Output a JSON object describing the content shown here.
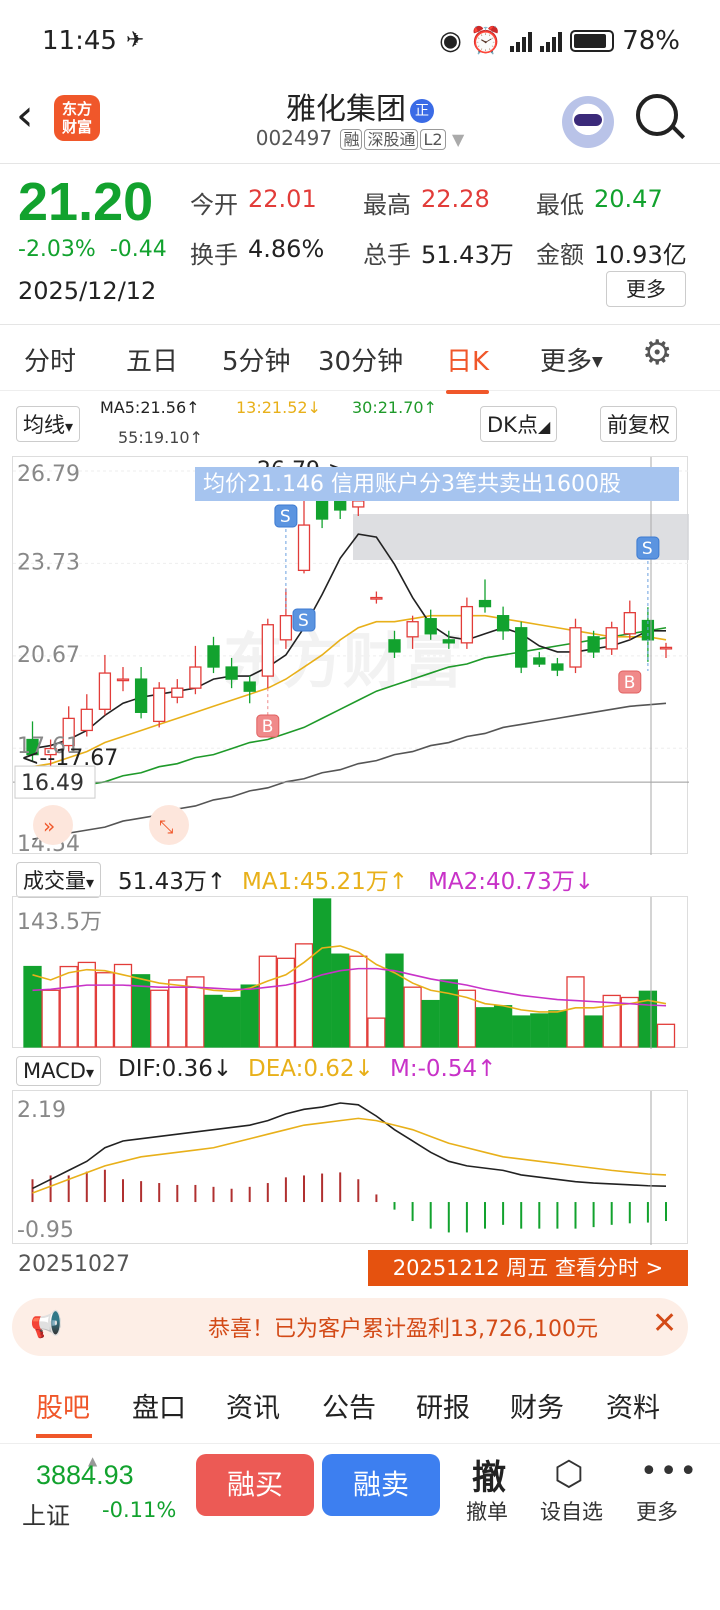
{
  "status": {
    "time": "11:45",
    "battery": "78%"
  },
  "header": {
    "logo_line1": "东方",
    "logo_line2": "财富",
    "stock_name": "雅化集团",
    "zheng": "正",
    "stock_code": "002497",
    "tag1": "融",
    "tag2": "深股通",
    "tag3": "L2"
  },
  "quote": {
    "price": "21.20",
    "change_pct": "-2.03%",
    "change": "-0.44",
    "date": "2025/12/12",
    "rows": [
      [
        {
          "label": "今开",
          "value": "22.01",
          "color": "red"
        },
        {
          "label": "最高",
          "value": "22.28",
          "color": "red"
        },
        {
          "label": "最低",
          "value": "20.47",
          "color": "green"
        }
      ],
      [
        {
          "label": "换手",
          "value": "4.86%",
          "color": "plain"
        },
        {
          "label": "总手",
          "value": "51.43万",
          "color": "plain"
        },
        {
          "label": "金额",
          "value": "10.93亿",
          "color": "plain"
        }
      ]
    ],
    "more": "更多"
  },
  "tabs": [
    "分时",
    "五日",
    "5分钟",
    "30分钟",
    "日K",
    "更多"
  ],
  "ma": {
    "type": "均线",
    "ma5": "MA5:21.56↑",
    "ma13": "13:21.52↓",
    "ma30": "30:21.70↑",
    "ma55": "55:19.10↑",
    "dk": "DK点",
    "adjust": "前复权"
  },
  "kchart": {
    "y_top": "26.79",
    "y_mid1": "23.73",
    "y_mid2": "20.67",
    "y_low": "17.61",
    "y_bottom": "14.54",
    "current_line": "16.49",
    "high_marker": "26.79->",
    "low_marker": "<--17.67",
    "banner": "均价21.146  信用账户分3笔共卖出1600股",
    "watermark": "东方财富",
    "b_label": "B",
    "s_label": "S"
  },
  "volume": {
    "label": "成交量",
    "value": "51.43万↑",
    "ma1": "MA1:45.21万↑",
    "ma2": "MA2:40.73万↓",
    "y_top": "143.5万"
  },
  "macd": {
    "label": "MACD",
    "dif": "DIF:0.36↓",
    "dea": "DEA:0.62↓",
    "m": "M:-0.54↑",
    "y_top": "2.19",
    "y_bottom": "-0.95"
  },
  "dates": {
    "start": "20251027",
    "end_button": "20251212 周五 查看分时 >"
  },
  "notice": {
    "text": "恭喜！已为客户累计盈利13,726,100元"
  },
  "bottom_tabs": [
    "股吧",
    "盘口",
    "资讯",
    "公告",
    "研报",
    "财务",
    "资料"
  ],
  "footer": {
    "index_value": "3884.93",
    "index_name": "上证",
    "index_change": "-0.11%",
    "buy": "融买",
    "sell": "融卖",
    "cancel_big": "撤",
    "cancel": "撤单",
    "watch": "设自选",
    "more": "更多"
  },
  "colors": {
    "up": "#e23c39",
    "down": "#12a22e",
    "accent": "#f0572a",
    "buy_btn": "#ec5a55",
    "sell_btn": "#3d7ff0"
  },
  "chart_data": {
    "type": "candlestick",
    "y_range": [
      14.54,
      26.79
    ],
    "candles": [
      {
        "o": 17.9,
        "c": 17.4,
        "h": 18.5,
        "l": 17.2
      },
      {
        "o": 17.4,
        "c": 17.6,
        "h": 17.9,
        "l": 17.0
      },
      {
        "o": 17.7,
        "c": 18.6,
        "h": 19.0,
        "l": 17.5
      },
      {
        "o": 18.2,
        "c": 18.9,
        "h": 19.4,
        "l": 18.0
      },
      {
        "o": 18.9,
        "c": 20.1,
        "h": 20.7,
        "l": 18.7
      },
      {
        "o": 19.9,
        "c": 19.9,
        "h": 20.3,
        "l": 19.5
      },
      {
        "o": 19.9,
        "c": 18.8,
        "h": 20.3,
        "l": 18.6
      },
      {
        "o": 18.5,
        "c": 19.6,
        "h": 19.8,
        "l": 18.3
      },
      {
        "o": 19.3,
        "c": 19.6,
        "h": 19.9,
        "l": 19.1
      },
      {
        "o": 19.6,
        "c": 20.3,
        "h": 21.0,
        "l": 19.4
      },
      {
        "o": 21.0,
        "c": 20.3,
        "h": 21.3,
        "l": 20.1
      },
      {
        "o": 20.3,
        "c": 19.9,
        "h": 20.6,
        "l": 19.6
      },
      {
        "o": 19.8,
        "c": 19.5,
        "h": 20.0,
        "l": 19.1
      },
      {
        "o": 20.0,
        "c": 21.7,
        "h": 21.9,
        "l": 19.6
      },
      {
        "o": 21.2,
        "c": 22.0,
        "h": 22.9,
        "l": 20.9
      },
      {
        "o": 23.5,
        "c": 25.0,
        "h": 25.9,
        "l": 23.4
      },
      {
        "o": 26.2,
        "c": 25.2,
        "h": 26.5,
        "l": 24.9
      },
      {
        "o": 25.9,
        "c": 25.5,
        "h": 26.2,
        "l": 25.2
      },
      {
        "o": 25.6,
        "c": 25.8,
        "h": 26.79,
        "l": 25.3
      },
      {
        "o": 22.6,
        "c": 22.6,
        "h": 22.8,
        "l": 22.4
      },
      {
        "o": 21.2,
        "c": 20.8,
        "h": 21.5,
        "l": 20.6
      },
      {
        "o": 21.3,
        "c": 21.8,
        "h": 22.0,
        "l": 20.9
      },
      {
        "o": 21.9,
        "c": 21.4,
        "h": 22.2,
        "l": 21.2
      },
      {
        "o": 21.2,
        "c": 21.1,
        "h": 21.5,
        "l": 20.9
      },
      {
        "o": 21.1,
        "c": 22.3,
        "h": 22.6,
        "l": 20.9
      },
      {
        "o": 22.5,
        "c": 22.3,
        "h": 23.2,
        "l": 22.1
      },
      {
        "o": 22.0,
        "c": 21.5,
        "h": 22.3,
        "l": 21.2
      },
      {
        "o": 21.6,
        "c": 20.3,
        "h": 21.8,
        "l": 20.1
      },
      {
        "o": 20.6,
        "c": 20.4,
        "h": 20.8,
        "l": 20.3
      },
      {
        "o": 20.4,
        "c": 20.2,
        "h": 20.6,
        "l": 20.0
      },
      {
        "o": 20.3,
        "c": 21.6,
        "h": 21.9,
        "l": 20.1
      },
      {
        "o": 21.3,
        "c": 20.8,
        "h": 21.5,
        "l": 20.6
      },
      {
        "o": 20.9,
        "c": 21.6,
        "h": 21.8,
        "l": 20.7
      },
      {
        "o": 21.4,
        "c": 22.1,
        "h": 22.5,
        "l": 21.2
      },
      {
        "o": 21.84,
        "c": 21.2,
        "h": 22.28,
        "l": 20.47
      },
      {
        "o": 20.95,
        "c": 20.95,
        "h": 21.1,
        "l": 20.6
      }
    ],
    "ma5": [
      17.6,
      17.7,
      17.9,
      18.2,
      18.7,
      19.1,
      19.3,
      19.4,
      19.5,
      19.6,
      19.9,
      20.0,
      20.0,
      20.3,
      20.7,
      21.6,
      22.7,
      23.9,
      24.7,
      24.6,
      23.7,
      22.6,
      21.7,
      21.3,
      21.2,
      21.4,
      21.6,
      21.4,
      21.0,
      20.8,
      20.8,
      20.9,
      21.0,
      21.2,
      21.5,
      21.5
    ],
    "ma13": [
      17.0,
      17.1,
      17.3,
      17.5,
      17.8,
      18.0,
      18.2,
      18.4,
      18.6,
      18.8,
      19.0,
      19.2,
      19.4,
      19.6,
      19.9,
      20.3,
      20.7,
      21.2,
      21.6,
      21.8,
      21.8,
      21.9,
      22.0,
      22.0,
      22.0,
      22.0,
      21.9,
      21.8,
      21.7,
      21.6,
      21.5,
      21.4,
      21.3,
      21.3,
      21.3,
      21.2
    ],
    "ma30": [
      16.0,
      16.1,
      16.2,
      16.4,
      16.5,
      16.7,
      16.8,
      17.0,
      17.1,
      17.3,
      17.4,
      17.6,
      17.8,
      17.9,
      18.1,
      18.3,
      18.6,
      18.9,
      19.2,
      19.5,
      19.7,
      19.9,
      20.1,
      20.3,
      20.4,
      20.6,
      20.7,
      20.8,
      20.9,
      21.0,
      21.1,
      21.2,
      21.3,
      21.4,
      21.5,
      21.6
    ],
    "ma55": [
      14.6,
      14.7,
      14.8,
      14.9,
      15.0,
      15.2,
      15.3,
      15.4,
      15.6,
      15.7,
      15.9,
      16.0,
      16.2,
      16.3,
      16.5,
      16.6,
      16.8,
      16.9,
      17.1,
      17.2,
      17.4,
      17.5,
      17.7,
      17.8,
      18.0,
      18.1,
      18.3,
      18.4,
      18.5,
      18.6,
      18.7,
      18.8,
      18.9,
      19.0,
      19.05,
      19.1
    ],
    "volume": {
      "y_range": [
        0,
        143.5
      ],
      "values": [
        78,
        55,
        78,
        82,
        72,
        80,
        70,
        55,
        65,
        68,
        50,
        48,
        60,
        88,
        86,
        100,
        143.5,
        90,
        88,
        28,
        90,
        58,
        45,
        65,
        55,
        38,
        40,
        30,
        32,
        35,
        68,
        30,
        50,
        48,
        54,
        22
      ],
      "ma1": [
        70,
        65,
        72,
        75,
        74,
        70,
        66,
        62,
        60,
        58,
        55,
        54,
        57,
        64,
        70,
        82,
        96,
        98,
        92,
        80,
        72,
        62,
        55,
        52,
        48,
        42,
        40,
        36,
        34,
        34,
        38,
        38,
        40,
        42,
        45.21,
        42
      ],
      "ma2": [
        55,
        56,
        58,
        60,
        60,
        60,
        59,
        58,
        58,
        58,
        57,
        56,
        56,
        58,
        60,
        64,
        70,
        74,
        76,
        76,
        74,
        70,
        66,
        63,
        60,
        56,
        53,
        50,
        48,
        46,
        45,
        44,
        43,
        42,
        40.73,
        40
      ]
    },
    "macd": {
      "y_range": [
        -0.95,
        2.19
      ],
      "dif": [
        0.3,
        0.5,
        0.7,
        0.9,
        1.2,
        1.35,
        1.4,
        1.45,
        1.5,
        1.55,
        1.6,
        1.65,
        1.7,
        1.8,
        1.95,
        2.05,
        2.1,
        2.19,
        2.15,
        1.9,
        1.6,
        1.35,
        1.1,
        0.9,
        0.8,
        0.75,
        0.7,
        0.6,
        0.55,
        0.5,
        0.45,
        0.42,
        0.4,
        0.38,
        0.36,
        0.35
      ],
      "dea": [
        0.2,
        0.35,
        0.5,
        0.65,
        0.8,
        0.9,
        1.0,
        1.05,
        1.1,
        1.15,
        1.2,
        1.3,
        1.4,
        1.5,
        1.6,
        1.7,
        1.75,
        1.8,
        1.85,
        1.8,
        1.7,
        1.6,
        1.45,
        1.3,
        1.2,
        1.1,
        1.0,
        0.95,
        0.9,
        0.85,
        0.8,
        0.75,
        0.7,
        0.66,
        0.62,
        0.6
      ],
      "hist": [
        0.6,
        0.7,
        0.7,
        0.8,
        0.85,
        0.6,
        0.55,
        0.5,
        0.45,
        0.45,
        0.4,
        0.35,
        0.4,
        0.5,
        0.65,
        0.7,
        0.75,
        0.78,
        0.6,
        0.2,
        -0.2,
        -0.5,
        -0.7,
        -0.8,
        -0.8,
        -0.7,
        -0.6,
        -0.7,
        -0.7,
        -0.7,
        -0.7,
        -0.66,
        -0.6,
        -0.56,
        -0.54,
        -0.5
      ]
    }
  }
}
